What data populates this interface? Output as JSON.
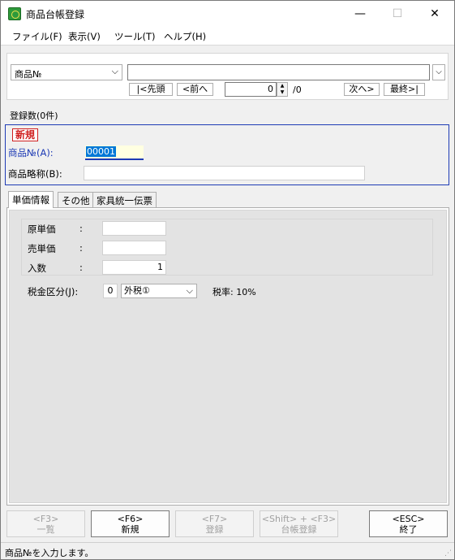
{
  "window": {
    "title": "商品台帳登録",
    "minimize": "—",
    "maximize": "☐",
    "close": "✕"
  },
  "menu": [
    {
      "label": "ファイル(F)"
    },
    {
      "label": "表示(V)"
    },
    {
      "label": "ツール(T)"
    },
    {
      "label": "ヘルプ(H)"
    }
  ],
  "nav": {
    "field_select": "商品№",
    "search_value": "",
    "first": "|<先頭",
    "prev": "<前へ",
    "record_no": "0",
    "total": "/0",
    "next": "次へ>",
    "last": "最終>|"
  },
  "record_count": "登録数(0件)",
  "form": {
    "badge": "新規",
    "code_label": "商品№(A):",
    "code_value": "00001",
    "short_label": "商品略称(B):",
    "short_value": ""
  },
  "tabs": [
    {
      "label": "単価情報",
      "active": true
    },
    {
      "label": "その他",
      "active": false
    },
    {
      "label": "家具統一伝票",
      "active": false
    }
  ],
  "pricing": {
    "cost_label": "原単価",
    "cost_value": "",
    "sell_label": "売単価",
    "sell_value": "",
    "qty_label": "入数",
    "qty_value": "1",
    "colon": ":",
    "tax_label": "税金区分(J):",
    "tax_code": "0",
    "tax_option": "外税①",
    "tax_rate": "税率: 10%"
  },
  "fkeys": [
    {
      "key": "<F3>",
      "label": "一覧",
      "enabled": false
    },
    {
      "key": "<F6>",
      "label": "新規",
      "enabled": true
    },
    {
      "key": "<F7>",
      "label": "登録",
      "enabled": false
    },
    {
      "key": "<Shift> + <F3>",
      "label": "台帳登録",
      "enabled": false
    },
    {
      "key": "<ESC>",
      "label": "終了",
      "enabled": true
    }
  ],
  "status": "商品№を入力します。",
  "colors": {
    "accent": "#1e3bb5",
    "badge_red": "#d02020",
    "selection": "#0078d7"
  }
}
